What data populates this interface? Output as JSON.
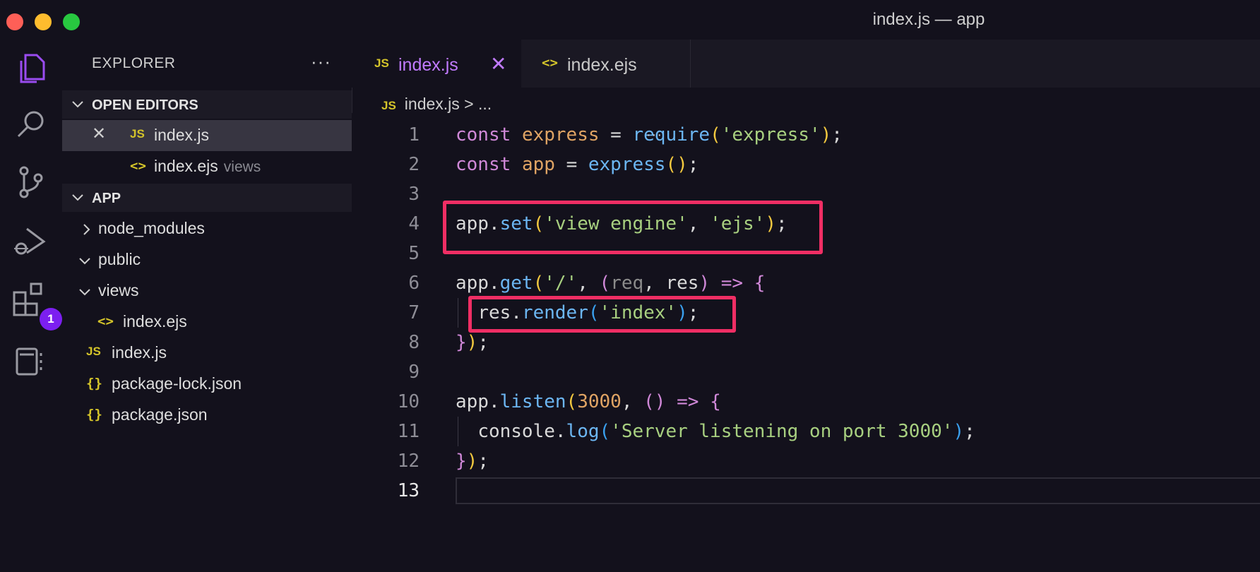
{
  "window": {
    "title": "index.js — app"
  },
  "activity_bar": {
    "extensions_badge": "1"
  },
  "sidebar": {
    "header": "EXPLORER",
    "more": "···",
    "open_editors": {
      "title": "OPEN EDITORS",
      "items": [
        {
          "name": "index.js",
          "hint": ""
        },
        {
          "name": "index.ejs",
          "hint": "views"
        }
      ]
    },
    "app": {
      "title": "APP",
      "items": [
        {
          "name": "node_modules"
        },
        {
          "name": "public"
        },
        {
          "name": "views"
        },
        {
          "name": "index.ejs"
        },
        {
          "name": "index.js"
        },
        {
          "name": "package-lock.json"
        },
        {
          "name": "package.json"
        }
      ]
    }
  },
  "tabs": [
    {
      "label": "index.js",
      "icon": "JS"
    },
    {
      "label": "index.ejs",
      "icon": "<>"
    }
  ],
  "breadcrumb": {
    "icon": "JS",
    "file": "index.js",
    "rest": "> ..."
  },
  "editor": {
    "line_numbers": [
      "1",
      "2",
      "3",
      "4",
      "5",
      "6",
      "7",
      "8",
      "9",
      "10",
      "11",
      "12",
      "13"
    ],
    "current_line": 13,
    "lines": [
      "const express = require('express');",
      "const app = express();",
      "",
      "app.set('view engine', 'ejs');",
      "",
      "app.get('/', (req, res) => {",
      "  res.render('index');",
      "});",
      "",
      "app.listen(3000, () => {",
      "  console.log('Server listening on port 3000');",
      "});",
      ""
    ]
  },
  "highlight_color": "#f02e64",
  "icons": [
    "explorer-icon",
    "search-icon",
    "source-control-icon",
    "run-debug-icon",
    "extensions-icon",
    "remote-explorer-icon"
  ]
}
